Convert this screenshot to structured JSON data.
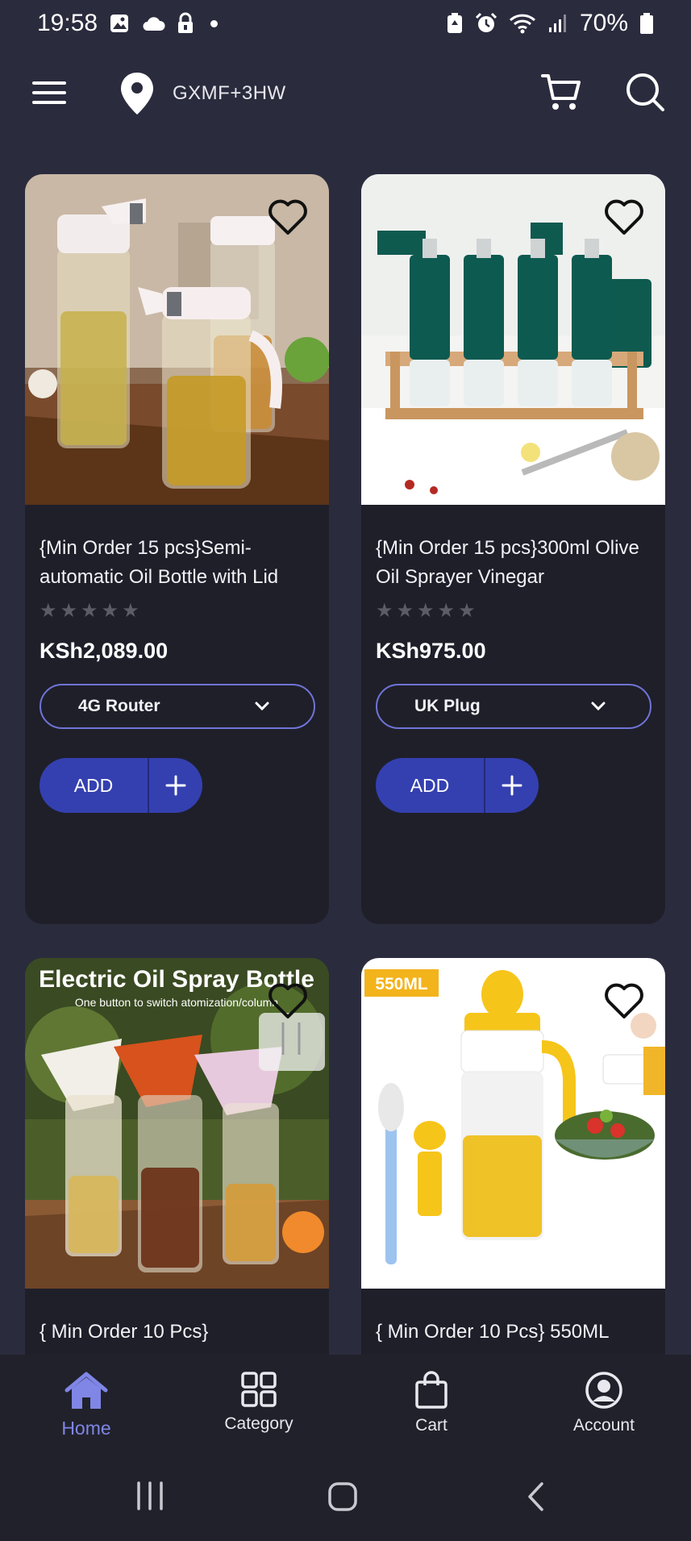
{
  "status_bar": {
    "time": "19:58",
    "battery": "70%"
  },
  "header": {
    "location": "GXMF+3HW"
  },
  "products": [
    {
      "title": "{Min Order 15 pcs}Semi-automatic Oil Bottle with Lid",
      "rating": 0,
      "price": "KSh2,089.00",
      "variant": "4G Router",
      "add_label": "ADD"
    },
    {
      "title": "{Min Order 15 pcs}300ml Olive Oil Sprayer Vinegar",
      "rating": 0,
      "price": "KSh975.00",
      "variant": "UK Plug",
      "add_label": "ADD"
    },
    {
      "title": "{ Min Order 10 Pcs}",
      "image_text": "Electric Oil Spray Bottle",
      "image_subtext": "One button to switch atomization/column"
    },
    {
      "title": "{ Min Order 10 Pcs} 550ML",
      "image_badge": "550ML"
    }
  ],
  "bottom_nav": {
    "items": [
      {
        "label": "Home",
        "active": true
      },
      {
        "label": "Category",
        "active": false
      },
      {
        "label": "Cart",
        "active": false
      },
      {
        "label": "Account",
        "active": false
      }
    ]
  },
  "colors": {
    "background": "#2a2b3d",
    "card": "#1f1f2a",
    "accent": "#3440b0",
    "accent_light": "#7f86e6"
  }
}
